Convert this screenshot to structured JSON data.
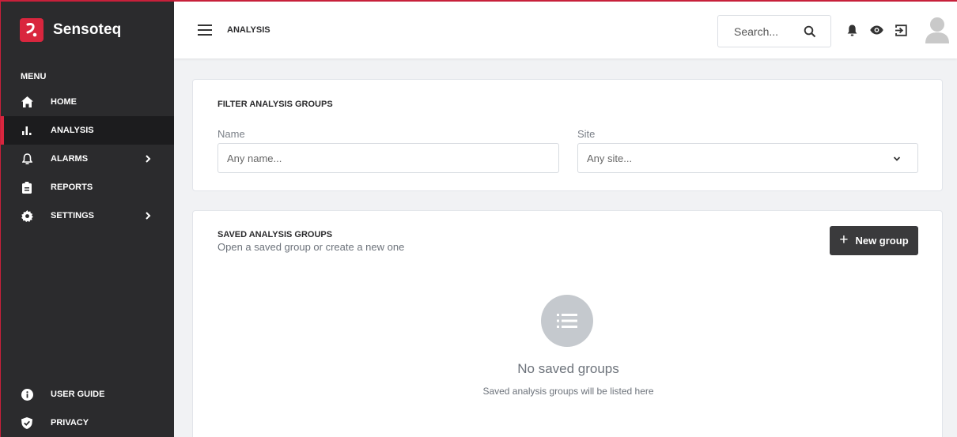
{
  "brand": {
    "name": "Sensoteq"
  },
  "sidebar": {
    "menu_header": "MENU",
    "items": [
      {
        "label": "HOME",
        "icon": "home-icon",
        "active": false,
        "has_submenu": false
      },
      {
        "label": "ANALYSIS",
        "icon": "bar-chart-icon",
        "active": true,
        "has_submenu": false
      },
      {
        "label": "ALARMS",
        "icon": "bell-icon",
        "active": false,
        "has_submenu": true
      },
      {
        "label": "REPORTS",
        "icon": "clipboard-icon",
        "active": false,
        "has_submenu": false
      },
      {
        "label": "SETTINGS",
        "icon": "gear-icon",
        "active": false,
        "has_submenu": true
      }
    ],
    "bottom_items": [
      {
        "label": "USER GUIDE",
        "icon": "info-icon"
      },
      {
        "label": "PRIVACY",
        "icon": "shield-check-icon"
      }
    ]
  },
  "topbar": {
    "title": "ANALYSIS",
    "search_placeholder": "Search...",
    "icons": [
      "hamburger-icon",
      "search-icon",
      "bell-icon",
      "eye-icon",
      "logout-icon",
      "avatar-icon"
    ]
  },
  "filter": {
    "title": "FILTER ANALYSIS GROUPS",
    "name_label": "Name",
    "name_placeholder": "Any name...",
    "site_label": "Site",
    "site_value": "Any site..."
  },
  "saved": {
    "title": "SAVED ANALYSIS GROUPS",
    "subtitle": "Open a saved group or create a new one",
    "new_button": "New group",
    "empty_title": "No saved groups",
    "empty_subtitle": "Saved analysis groups will be listed here"
  },
  "colors": {
    "accent": "#d9263e",
    "sidebar_bg": "#2b2b2d",
    "button_bg": "#3a3a3c"
  }
}
